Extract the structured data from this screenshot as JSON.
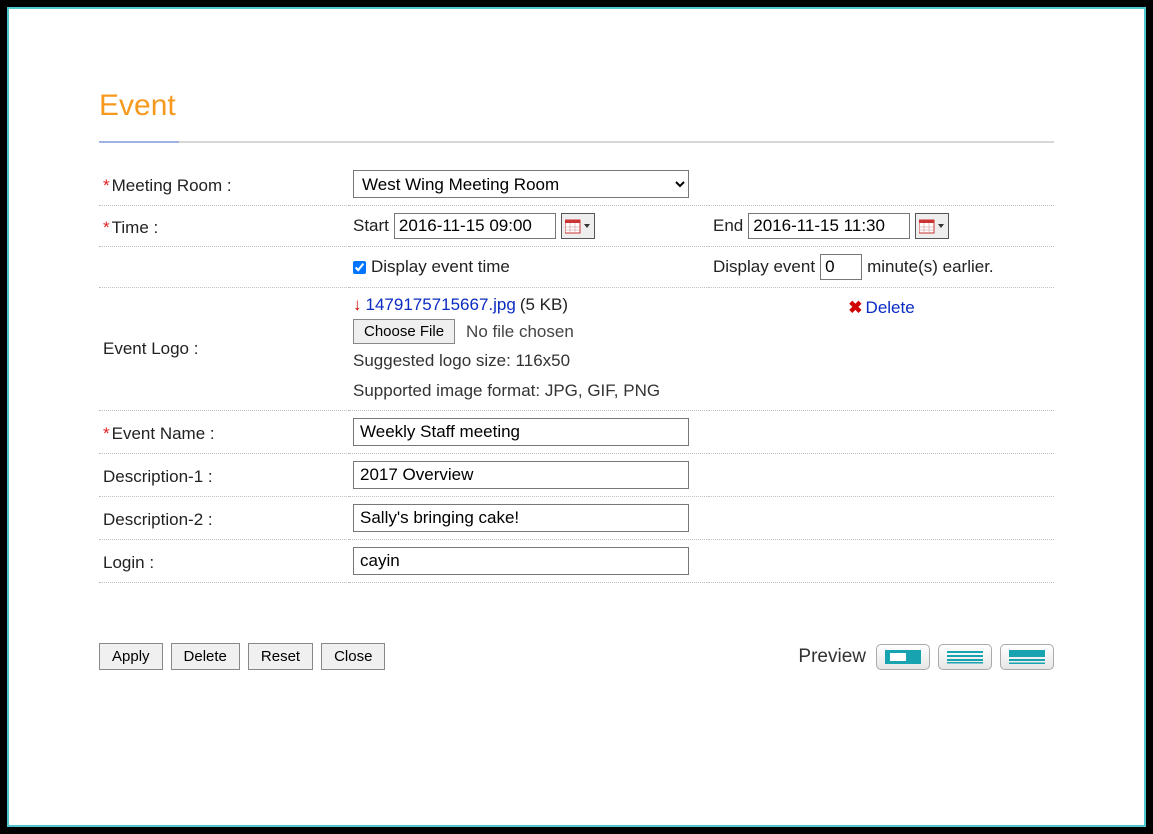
{
  "title": "Event",
  "labels": {
    "meeting_room": "Meeting Room :",
    "time": "Time :",
    "start": "Start",
    "end": "End",
    "display_event_time": "Display event time",
    "display_event": "Display event",
    "minutes_earlier": "minute(s) earlier.",
    "event_logo": "Event Logo :",
    "choose_file": "Choose File",
    "no_file_chosen": "No file chosen",
    "suggested_size": "Suggested logo size: 116x50",
    "supported_format": "Supported image format: JPG, GIF, PNG",
    "delete": "Delete",
    "event_name": "Event Name :",
    "description_1": "Description-1 :",
    "description_2": "Description-2 :",
    "login": "Login :",
    "preview": "Preview"
  },
  "values": {
    "meeting_room_selected": "West Wing Meeting Room",
    "start_time": "2016-11-15 09:00",
    "end_time": "2016-11-15 11:30",
    "display_event_time_checked": true,
    "minutes_earlier": "0",
    "logo_filename": "1479175715667.jpg",
    "logo_filesize": "(5 KB)",
    "event_name": "Weekly Staff meeting",
    "description_1": "2017 Overview",
    "description_2": "Sally's bringing cake!",
    "login": "cayin"
  },
  "footer_buttons": {
    "apply": "Apply",
    "delete": "Delete",
    "reset": "Reset",
    "close": "Close"
  }
}
